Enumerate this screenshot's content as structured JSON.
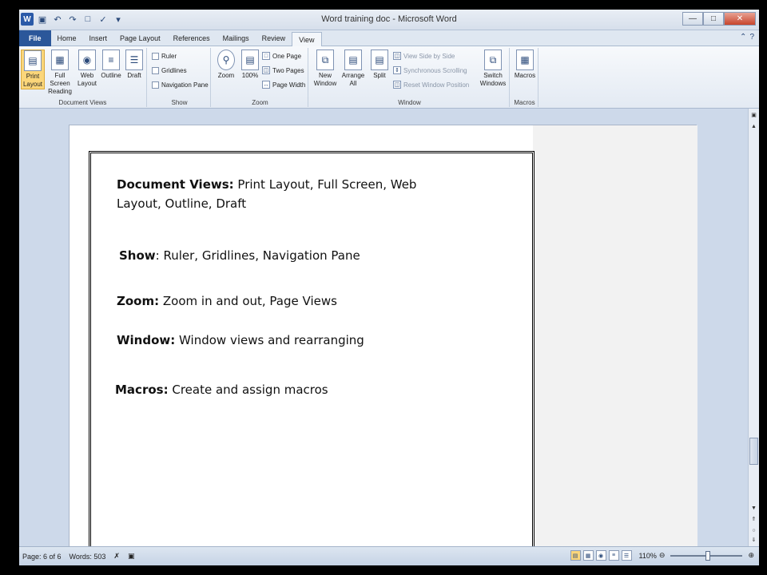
{
  "window": {
    "title": "Word training doc - Microsoft Word",
    "app_icon": "W",
    "controls": [
      "minimize",
      "maximize",
      "close"
    ]
  },
  "tabs": [
    {
      "label": "File",
      "kind": "file"
    },
    {
      "label": "Home"
    },
    {
      "label": "Insert"
    },
    {
      "label": "Page Layout"
    },
    {
      "label": "References"
    },
    {
      "label": "Mailings"
    },
    {
      "label": "Review"
    },
    {
      "label": "View",
      "active": true
    }
  ],
  "ribbon": {
    "document_views": {
      "label": "Document Views",
      "buttons": [
        "Print Layout",
        "Full Screen Reading",
        "Web Layout",
        "Outline",
        "Draft"
      ]
    },
    "show": {
      "label": "Show",
      "checkboxes": [
        "Ruler",
        "Gridlines",
        "Navigation Pane"
      ]
    },
    "zoom": {
      "label": "Zoom",
      "buttons": [
        "Zoom",
        "100%"
      ],
      "small": [
        "One Page",
        "Two Pages",
        "Page Width"
      ]
    },
    "window": {
      "label": "Window",
      "buttons": [
        "New Window",
        "Arrange All",
        "Split"
      ],
      "small_disabled": [
        "View Side by Side",
        "Synchronous Scrolling",
        "Reset Window Position"
      ],
      "switch": "Switch Windows"
    },
    "macros": {
      "label": "Macros",
      "button": "Macros"
    }
  },
  "document": {
    "lines": [
      {
        "bold": "Document Views:",
        "rest": " Print Layout, Full Screen, Web"
      },
      {
        "bold": "",
        "rest": "Layout, Outline, Draft"
      },
      {
        "bold": "Show",
        "rest": ":  Ruler, Gridlines, Navigation Pane"
      },
      {
        "bold": "Zoom:",
        "rest": "  Zoom in and out, Page Views"
      },
      {
        "bold": "Window:",
        "rest": "  Window views and rearranging"
      },
      {
        "bold": "Macros:",
        "rest": "  Create and assign macros"
      }
    ]
  },
  "status": {
    "page": "Page: 6 of 6",
    "words": "Words: 503",
    "zoom": "110%"
  },
  "colors": {
    "file_tab": "#2b579a",
    "ribbon_bg": "#e3eaf3",
    "selected_button": "#fbd67a"
  }
}
